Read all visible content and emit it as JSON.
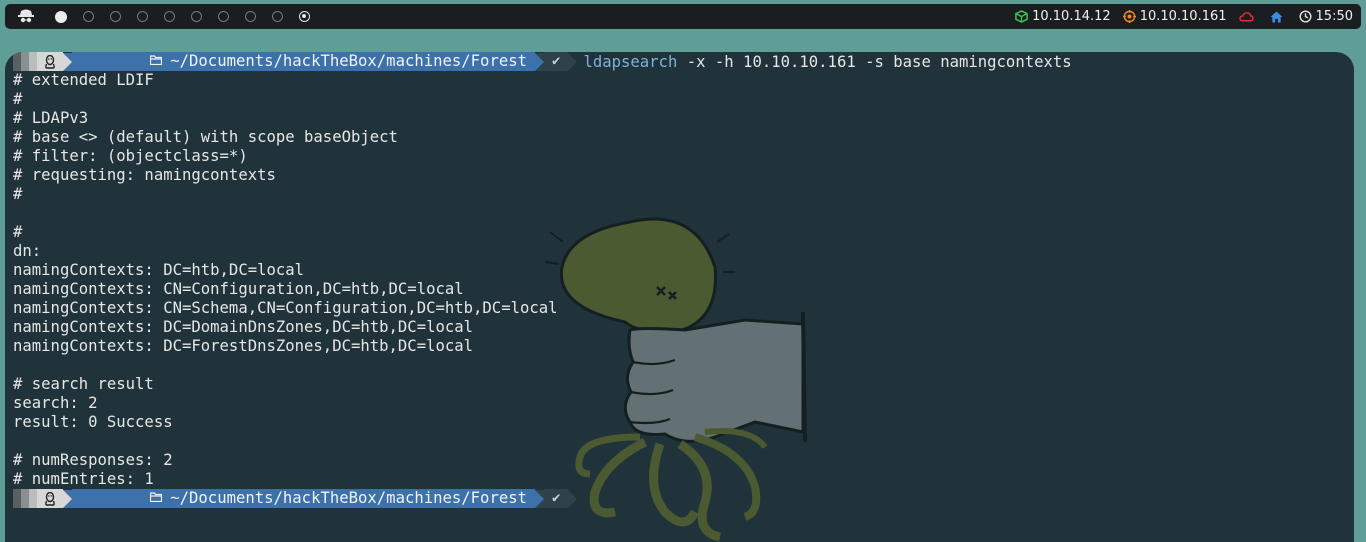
{
  "topbar": {
    "workspaces": [
      {
        "state": "active"
      },
      {
        "state": "empty"
      },
      {
        "state": "empty"
      },
      {
        "state": "empty"
      },
      {
        "state": "empty"
      },
      {
        "state": "empty"
      },
      {
        "state": "empty"
      },
      {
        "state": "empty"
      },
      {
        "state": "empty"
      },
      {
        "state": "target"
      }
    ],
    "vpn_ip": "10.10.14.12",
    "target_ip": "10.10.10.161",
    "time": "15:50",
    "colors": {
      "vpn": "#36c94f",
      "target": "#f08a1c",
      "cloud": "#e0313a",
      "home": "#3b8de0"
    }
  },
  "terminal": {
    "prompt": {
      "path": "~/Documents/hackTheBox/machines/Forest",
      "status_glyph": "✔",
      "os_glyph": "🐧",
      "command_bin": "ldapsearch",
      "command_args": " -x -h 10.10.10.161 -s base namingcontexts"
    },
    "output": [
      "# extended LDIF",
      "#",
      "# LDAPv3",
      "# base <> (default) with scope baseObject",
      "# filter: (objectclass=*)",
      "# requesting: namingcontexts",
      "#",
      "",
      "#",
      "dn:",
      "namingContexts: DC=htb,DC=local",
      "namingContexts: CN=Configuration,DC=htb,DC=local",
      "namingContexts: CN=Schema,CN=Configuration,DC=htb,DC=local",
      "namingContexts: DC=DomainDnsZones,DC=htb,DC=local",
      "namingContexts: DC=ForestDnsZones,DC=htb,DC=local",
      "",
      "# search result",
      "search: 2",
      "result: 0 Success",
      "",
      "# numResponses: 2",
      "# numEntries: 1"
    ],
    "prompt2": {
      "path": "~/Documents/hackTheBox/machines/Forest",
      "status_glyph": "✔",
      "os_glyph": "🐧"
    }
  }
}
